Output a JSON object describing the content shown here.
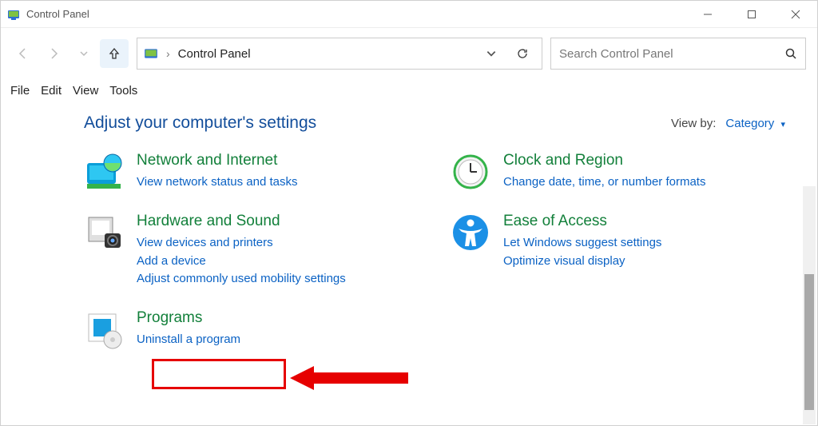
{
  "window": {
    "title": "Control Panel"
  },
  "breadcrumb": {
    "root": "Control Panel"
  },
  "search": {
    "placeholder": "Search Control Panel"
  },
  "menubar": {
    "items": [
      "File",
      "Edit",
      "View",
      "Tools"
    ]
  },
  "heading": "Adjust your computer's settings",
  "viewby": {
    "label": "View by:",
    "value": "Category"
  },
  "left_col": [
    {
      "title": "Network and Internet",
      "links": [
        "View network status and tasks"
      ]
    },
    {
      "title": "Hardware and Sound",
      "links": [
        "View devices and printers",
        "Add a device",
        "Adjust commonly used mobility settings"
      ]
    },
    {
      "title": "Programs",
      "links": [
        "Uninstall a program"
      ]
    }
  ],
  "right_col": [
    {
      "title": "Clock and Region",
      "links": [
        "Change date, time, or number formats"
      ]
    },
    {
      "title": "Ease of Access",
      "links": [
        "Let Windows suggest settings",
        "Optimize visual display"
      ]
    }
  ]
}
